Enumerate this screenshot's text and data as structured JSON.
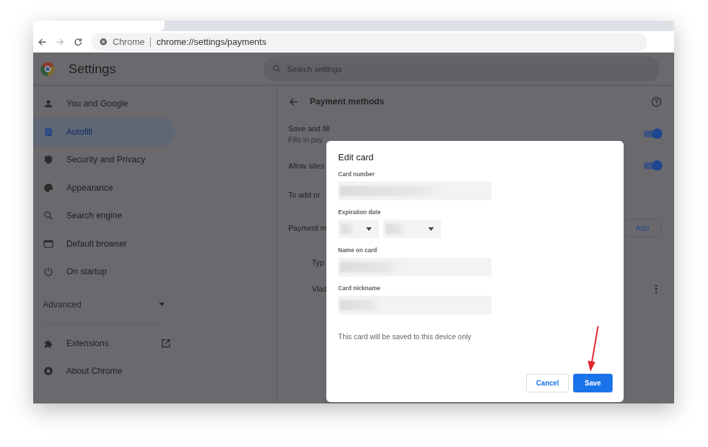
{
  "browser": {
    "site_label": "Chrome",
    "url": "chrome://settings/payments"
  },
  "header": {
    "title": "Settings",
    "search": {
      "placeholder": "Search settings"
    }
  },
  "sidebar": {
    "items": [
      {
        "label": "You and Google",
        "selected": false
      },
      {
        "label": "Autofill",
        "selected": true
      },
      {
        "label": "Security and Privacy",
        "selected": false
      },
      {
        "label": "Appearance",
        "selected": false
      },
      {
        "label": "Search engine",
        "selected": false
      },
      {
        "label": "Default browser",
        "selected": false
      },
      {
        "label": "On startup",
        "selected": false
      }
    ],
    "advanced": {
      "label": "Advanced",
      "expanded": false
    },
    "footer_items": [
      {
        "label": "Extensions"
      },
      {
        "label": "About Chrome"
      }
    ]
  },
  "main": {
    "title": "Payment methods",
    "rows": [
      {
        "kind": "toggle",
        "label": "Save and fill",
        "sublabel": "Fills in pay",
        "on": true
      },
      {
        "kind": "toggle",
        "label": "Allow sites",
        "on": true
      },
      {
        "kind": "text",
        "label": "To add or"
      },
      {
        "kind": "button",
        "label": "Payment m",
        "button": "Add"
      },
      {
        "kind": "sub",
        "label": "Typ"
      },
      {
        "kind": "more",
        "label": "Vlad"
      }
    ]
  },
  "dialog": {
    "title": "Edit card",
    "fields": [
      {
        "kind": "text",
        "label": "Card number"
      },
      {
        "kind": "selects",
        "label": "Expiration date"
      },
      {
        "kind": "text",
        "label": "Name on card"
      },
      {
        "kind": "text",
        "label": "Card nickname"
      }
    ],
    "note": "This card will be saved to this device only",
    "buttons": [
      {
        "label": "Cancel",
        "kind": "secondary"
      },
      {
        "label": "Save",
        "kind": "primary"
      }
    ]
  }
}
